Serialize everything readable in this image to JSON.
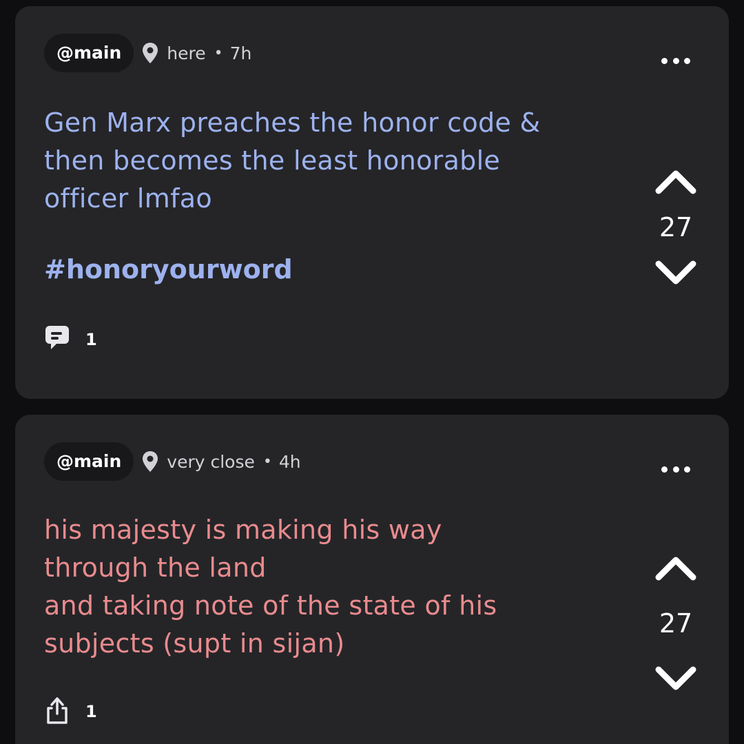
{
  "posts": [
    {
      "channel": "@main",
      "location": "here",
      "separator": "•",
      "age": "7h",
      "text": "Gen Marx preaches the honor code &\nthen becomes the least honorable\nofficer lmfao",
      "hashtag": "#honoryourword",
      "votes": "27",
      "footer_icon": "comment-icon",
      "footer_count": "1",
      "text_color": "#9db2ee"
    },
    {
      "channel": "@main",
      "location": "very close",
      "separator": "•",
      "age": "4h",
      "text": "his majesty is making his way\nthrough the land\nand taking note of the state of his\nsubjects (supt in sijan)",
      "votes": "27",
      "footer_icon": "share-icon",
      "footer_count": "1",
      "text_color": "#e98b8e"
    }
  ]
}
